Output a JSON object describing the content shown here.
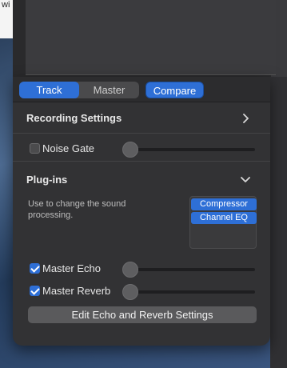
{
  "background": {
    "corner_text": "wi"
  },
  "toolbar": {
    "tabs": [
      {
        "label": "Track",
        "active": true
      },
      {
        "label": "Master",
        "active": false
      }
    ],
    "compare_label": "Compare"
  },
  "sections": {
    "recording": {
      "title": "Recording Settings"
    },
    "noise_gate": {
      "label": "Noise Gate",
      "checked": false,
      "level": 0
    },
    "plugins": {
      "title": "Plug-ins",
      "description": "Use to change the sound processing.",
      "items": [
        "Compressor",
        "Channel EQ"
      ]
    },
    "master_echo": {
      "label": "Master Echo",
      "checked": true,
      "level": 0
    },
    "master_reverb": {
      "label": "Master Reverb",
      "checked": true,
      "level": 0
    },
    "edit_button": "Edit Echo and Reverb Settings"
  },
  "colors": {
    "accent": "#2e6fd6",
    "panel": "#323234"
  },
  "icons": {
    "recording_chevron": "chevron-right-icon",
    "plugins_chevron": "chevron-down-icon"
  }
}
